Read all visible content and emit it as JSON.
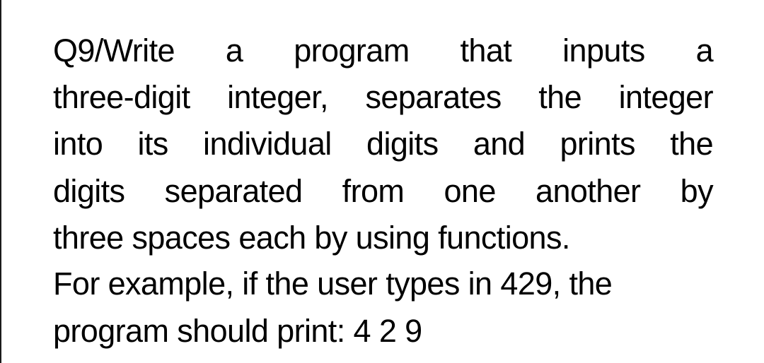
{
  "document": {
    "question_label": "Q9",
    "lines": [
      "Q9/Write a program that inputs a",
      "three-digit integer, separates the integer",
      "into its individual digits and prints the",
      "digits separated from one another by",
      "three spaces each by using functions.",
      "For example, if the user types in 429, the",
      "program should print: 4 2 9"
    ],
    "example_input": "429",
    "example_output": "4 2 9"
  }
}
